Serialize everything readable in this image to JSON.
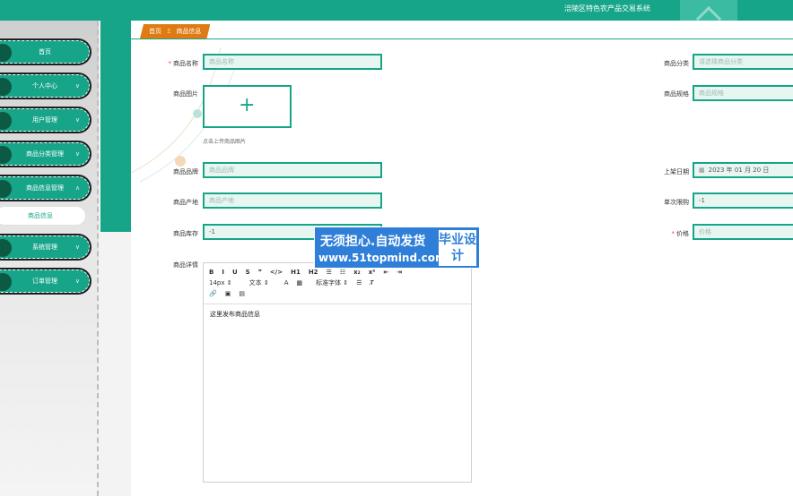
{
  "header": {
    "title": "涪陵区特色农产品交易系统"
  },
  "sidebar": {
    "items": [
      {
        "label": "首页",
        "arrow": ""
      },
      {
        "label": "个人中心",
        "arrow": "∨"
      },
      {
        "label": "用户管理",
        "arrow": "∨"
      },
      {
        "label": "商品分类管理",
        "arrow": "∨"
      },
      {
        "label": "商品信息管理",
        "arrow": "∧"
      },
      {
        "label": "系统管理",
        "arrow": "∨"
      },
      {
        "label": "订单管理",
        "arrow": "∨"
      }
    ],
    "sub_item": "商品信息"
  },
  "breadcrumb": {
    "home": "首页",
    "sep": "Ξ",
    "current": "商品信息"
  },
  "form": {
    "name": {
      "label": "商品名称",
      "placeholder": "商品名称"
    },
    "category": {
      "label": "商品分类",
      "placeholder": "请选择商品分类"
    },
    "image": {
      "label": "商品图片",
      "hint": "点击上传商品图片"
    },
    "spec": {
      "label": "商品规格",
      "placeholder": "商品规格"
    },
    "brand": {
      "label": "商品品牌",
      "placeholder": "商品品牌"
    },
    "date": {
      "label": "上架日期",
      "value": "2023 年 01 月 20 日"
    },
    "origin": {
      "label": "商品产地",
      "placeholder": "商品产地"
    },
    "limit": {
      "label": "单次限购",
      "value": "-1"
    },
    "stock": {
      "label": "商品库存",
      "value": "-1"
    },
    "price": {
      "label": "价格",
      "placeholder": "价格"
    },
    "detail": {
      "label": "商品详情",
      "content": "这里发布商品信息"
    }
  },
  "editor": {
    "row1": [
      "B",
      "I",
      "U",
      "S",
      "❞",
      "</>",
      "H1",
      "H2",
      "☰",
      "☷",
      "x₂",
      "x²",
      "⇤",
      "⇥"
    ],
    "size": "14px",
    "type": "文本",
    "font": "标准字体",
    "row3": [
      "🔗",
      "▣",
      "▤"
    ]
  },
  "watermark": {
    "line1": "无须担心.自动发货",
    "line2": "www.51topmind.com",
    "box": "毕业设计"
  }
}
